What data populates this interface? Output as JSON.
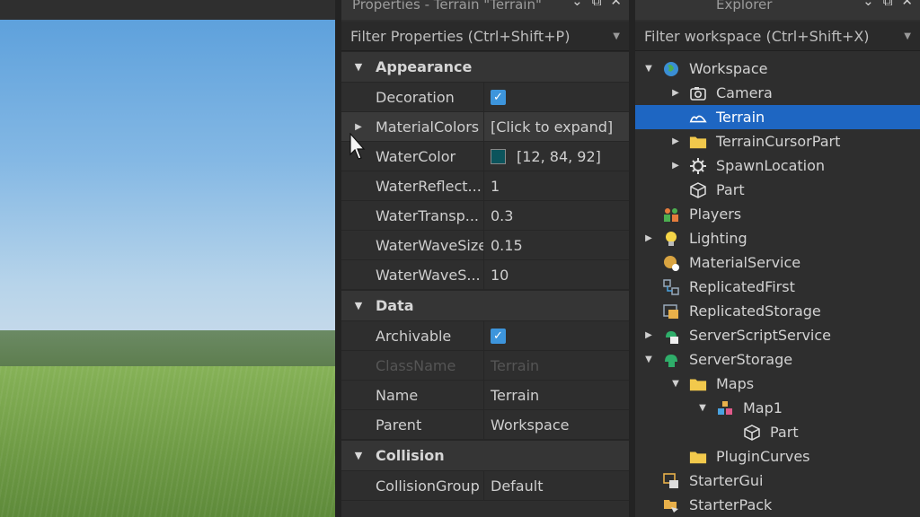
{
  "properties_panel": {
    "title": "Properties - Terrain \"Terrain\"",
    "filter_placeholder": "Filter Properties (Ctrl+Shift+P)",
    "sections": [
      {
        "name": "Appearance",
        "rows": [
          {
            "name": "Decoration",
            "type": "checkbox",
            "checked": true
          },
          {
            "name": "MaterialColors",
            "type": "text",
            "value": "[Click to expand]",
            "expandable": true
          },
          {
            "name": "WaterColor",
            "type": "color",
            "value": "[12, 84, 92]",
            "color": "#0c545c"
          },
          {
            "name": "WaterReflect...",
            "type": "text",
            "value": "1"
          },
          {
            "name": "WaterTransp...",
            "type": "text",
            "value": "0.3"
          },
          {
            "name": "WaterWaveSize",
            "type": "text",
            "value": "0.15"
          },
          {
            "name": "WaterWaveS...",
            "type": "text",
            "value": "10"
          }
        ]
      },
      {
        "name": "Data",
        "rows": [
          {
            "name": "Archivable",
            "type": "checkbox",
            "checked": true
          },
          {
            "name": "ClassName",
            "type": "text",
            "value": "Terrain",
            "disabled": true
          },
          {
            "name": "Name",
            "type": "text",
            "value": "Terrain"
          },
          {
            "name": "Parent",
            "type": "text",
            "value": "Workspace"
          }
        ]
      },
      {
        "name": "Collision",
        "rows": [
          {
            "name": "CollisionGroup",
            "type": "text",
            "value": "Default"
          }
        ]
      }
    ]
  },
  "explorer_panel": {
    "title": "Explorer",
    "filter_placeholder": "Filter workspace (Ctrl+Shift+X)",
    "items": [
      {
        "label": "Workspace",
        "depth": 0,
        "arrow": "expanded",
        "icon": "globe-icon"
      },
      {
        "label": "Camera",
        "depth": 1,
        "arrow": "collapsed",
        "icon": "camera-icon"
      },
      {
        "label": "Terrain",
        "depth": 1,
        "arrow": "none",
        "icon": "terrain-icon",
        "selected": true
      },
      {
        "label": "TerrainCursorPart",
        "depth": 1,
        "arrow": "collapsed",
        "icon": "folder-icon"
      },
      {
        "label": "SpawnLocation",
        "depth": 1,
        "arrow": "collapsed",
        "icon": "spawn-icon"
      },
      {
        "label": "Part",
        "depth": 1,
        "arrow": "none",
        "icon": "part-icon"
      },
      {
        "label": "Players",
        "depth": 0,
        "arrow": "none",
        "icon": "players-icon"
      },
      {
        "label": "Lighting",
        "depth": 0,
        "arrow": "collapsed",
        "icon": "lightbulb-icon"
      },
      {
        "label": "MaterialService",
        "depth": 0,
        "arrow": "none",
        "icon": "material-service-icon"
      },
      {
        "label": "ReplicatedFirst",
        "depth": 0,
        "arrow": "none",
        "icon": "replicated-first-icon"
      },
      {
        "label": "ReplicatedStorage",
        "depth": 0,
        "arrow": "none",
        "icon": "replicated-storage-icon"
      },
      {
        "label": "ServerScriptService",
        "depth": 0,
        "arrow": "collapsed",
        "icon": "server-script-service-icon"
      },
      {
        "label": "ServerStorage",
        "depth": 0,
        "arrow": "expanded",
        "icon": "server-storage-icon"
      },
      {
        "label": "Maps",
        "depth": 1,
        "arrow": "expanded",
        "icon": "folder-icon"
      },
      {
        "label": "Map1",
        "depth": 2,
        "arrow": "expanded",
        "icon": "model-icon"
      },
      {
        "label": "Part",
        "depth": 3,
        "arrow": "none",
        "icon": "part-icon"
      },
      {
        "label": "PluginCurves",
        "depth": 1,
        "arrow": "none",
        "icon": "folder-icon"
      },
      {
        "label": "StarterGui",
        "depth": 0,
        "arrow": "none",
        "icon": "starter-gui-icon"
      },
      {
        "label": "StarterPack",
        "depth": 0,
        "arrow": "none",
        "icon": "starter-pack-icon"
      }
    ]
  },
  "colors": {
    "selection": "#1e66c2",
    "checkbox": "#3d95dc",
    "panel_bg": "#2e2e2e"
  }
}
